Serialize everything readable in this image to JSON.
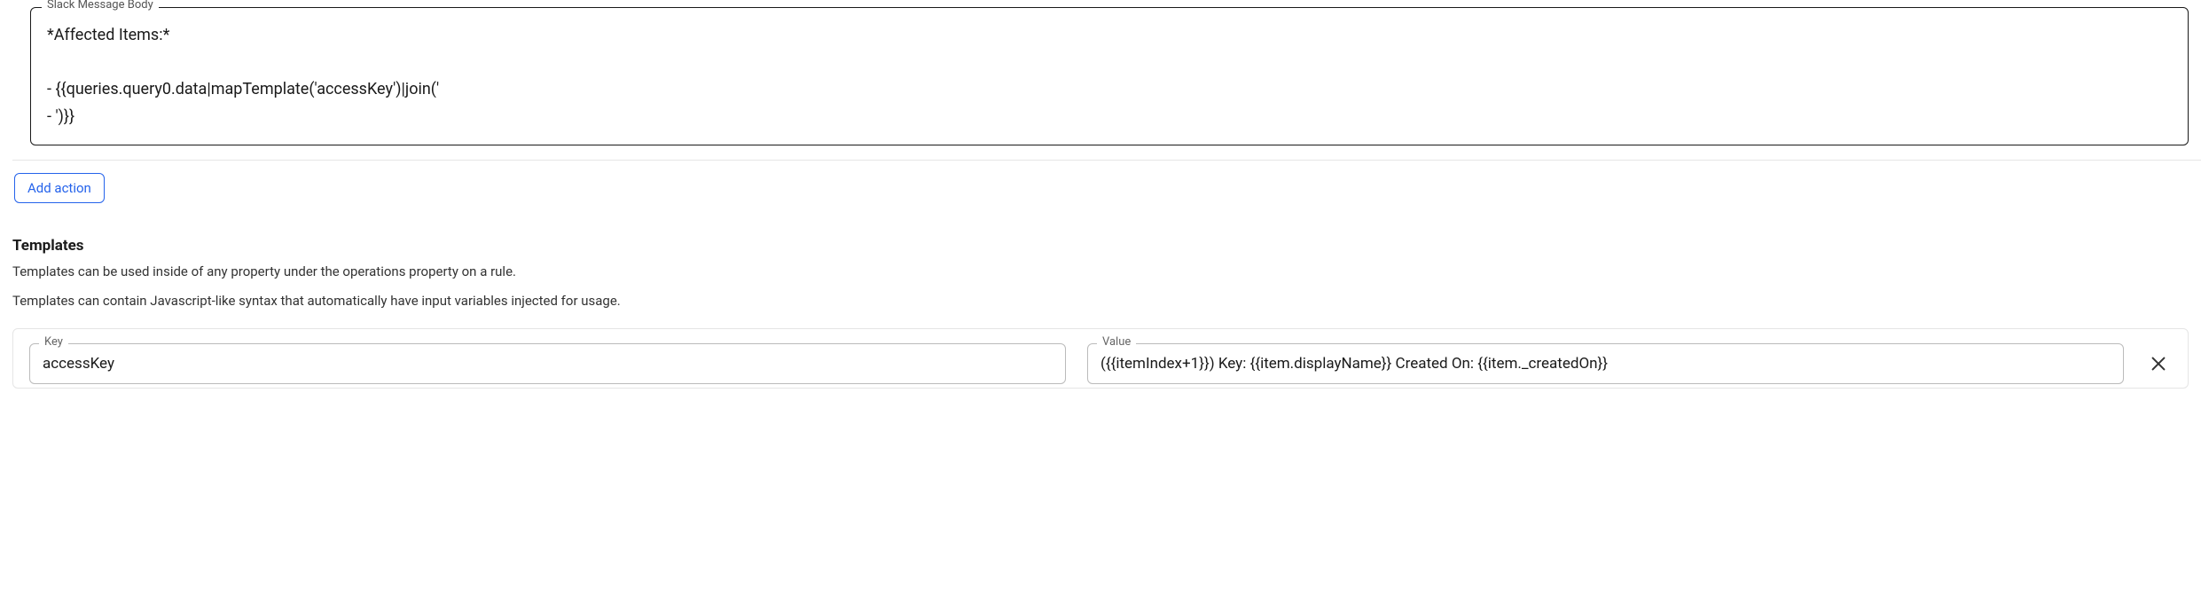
{
  "slackMessage": {
    "legend": "Slack Message Body",
    "value": "*Affected Items:*\n\n- {{queries.query0.data|mapTemplate('accessKey')|join('\n- ')}}"
  },
  "addAction": {
    "label": "Add action"
  },
  "templates": {
    "heading": "Templates",
    "description1": "Templates can be used inside of any property under the operations property on a rule.",
    "description2": "Templates can contain Javascript-like syntax that automatically have input variables injected for usage.",
    "rows": [
      {
        "keyLabel": "Key",
        "keyValue": "accessKey",
        "valueLabel": "Value",
        "valueValue": "({{itemIndex+1}}) Key: {{item.displayName}} Created On: {{item._createdOn}}"
      }
    ]
  }
}
